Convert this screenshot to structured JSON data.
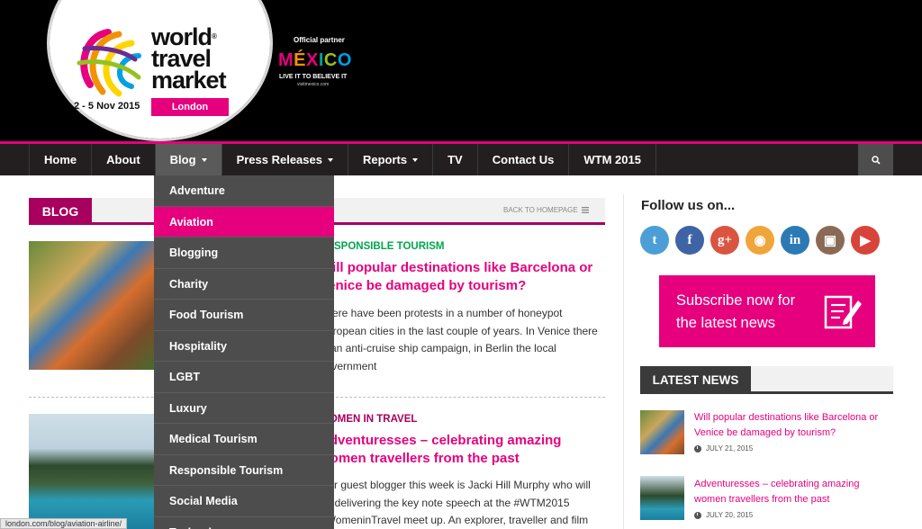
{
  "header": {
    "wtm_lines": [
      "world",
      "travel",
      "market"
    ],
    "wtm_reg": "®",
    "dates": "2 - 5 Nov 2015",
    "location": "London",
    "partner_label": "Official partner",
    "partner_letters": [
      "M",
      "É",
      "X",
      "I",
      "C",
      "O"
    ],
    "partner_slogan": "LIVE IT TO BELIEVE IT",
    "partner_url": "visitmexico.com",
    "brand_color": "#e6007e"
  },
  "nav": {
    "items": [
      {
        "label": "Home",
        "caret": false
      },
      {
        "label": "About",
        "caret": false
      },
      {
        "label": "Blog",
        "caret": true,
        "active": true
      },
      {
        "label": "Press Releases",
        "caret": true
      },
      {
        "label": "Reports",
        "caret": true
      },
      {
        "label": "TV",
        "caret": false
      },
      {
        "label": "Contact Us",
        "caret": false
      },
      {
        "label": "WTM 2015",
        "caret": false
      }
    ],
    "search_icon": "search-icon"
  },
  "dropdown": {
    "highlighted_index": 1,
    "items": [
      "Adventure",
      "Aviation",
      "Blogging",
      "Charity",
      "Food Tourism",
      "Hospitality",
      "LGBT",
      "Luxury",
      "Medical Tourism",
      "Responsible Tourism",
      "Social Media",
      "Technology"
    ]
  },
  "blog": {
    "tab_label": "BLOG",
    "back_label": "BACK TO HOMEPAGE"
  },
  "articles": [
    {
      "category": "RESPONSIBLE TOURISM",
      "category_color": "#00a651",
      "title_lines": [
        "Will popular destinations like Barcelona or",
        "Venice be damaged by tourism?"
      ],
      "excerpt_lines": [
        "There have been protests in a number of honeypot",
        "European cities in the last couple of years. In Venice there",
        "is an anti-cruise ship campaign, in Berlin the local",
        "government"
      ]
    },
    {
      "category": "WOMEN IN TRAVEL",
      "category_color": "#a7005e",
      "title_lines": [
        "Adventuresses – celebrating amazing",
        "women travellers from the past"
      ],
      "excerpt_lines": [
        "Our guest blogger this week is Jacki Hill Murphy who will",
        "be delivering the key note speech at the #WTM2015",
        "#WomeninTravel meet up. An explorer, traveller and film"
      ]
    }
  ],
  "status_url": "london.com/blog/aviation-airline/",
  "sidebar": {
    "follow_title": "Follow us on...",
    "socials": [
      {
        "name": "twitter-icon",
        "glyph": "t",
        "color": "#4c9fd6"
      },
      {
        "name": "facebook-icon",
        "glyph": "f",
        "color": "#3f64a6"
      },
      {
        "name": "google-plus-icon",
        "glyph": "g+",
        "color": "#d95540"
      },
      {
        "name": "rss-icon",
        "glyph": "◉",
        "color": "#f0a53a"
      },
      {
        "name": "linkedin-icon",
        "glyph": "in",
        "color": "#2b7ab6"
      },
      {
        "name": "instagram-icon",
        "glyph": "▣",
        "color": "#8a6a55"
      },
      {
        "name": "youtube-icon",
        "glyph": "▶",
        "color": "#d9443a"
      }
    ],
    "subscribe_text": "Subscribe now for the latest news",
    "latest_title": "LATEST NEWS",
    "news": [
      {
        "title": "Will popular destinations like Barcelona or Venice be damaged by tourism?",
        "date": "JULY 21, 2015"
      },
      {
        "title": "Adventuresses – celebrating amazing women travellers from the past",
        "date": "JULY 20, 2015"
      }
    ]
  }
}
